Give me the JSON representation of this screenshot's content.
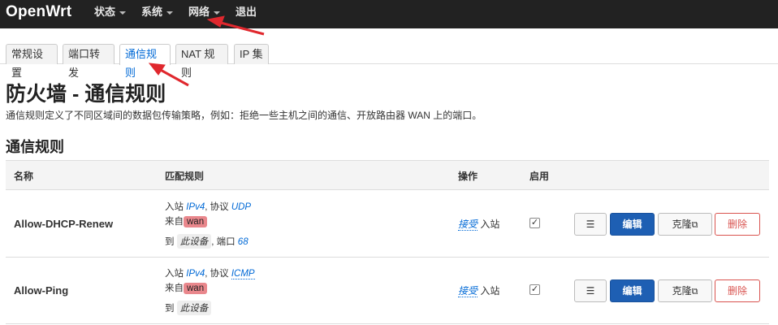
{
  "brand": "OpenWrt",
  "menu": [
    {
      "label": "状态",
      "has_caret": true
    },
    {
      "label": "系统",
      "has_caret": true
    },
    {
      "label": "网络",
      "has_caret": true
    },
    {
      "label": "退出",
      "has_caret": false
    }
  ],
  "tabs": [
    {
      "label": "常规设置",
      "active": false
    },
    {
      "label": "端口转发",
      "active": false
    },
    {
      "label": "通信规则",
      "active": true
    },
    {
      "label": "NAT 规则",
      "active": false
    },
    {
      "label": "IP 集",
      "active": false
    }
  ],
  "page": {
    "title": "防火墙 - 通信规则",
    "description": "通信规则定义了不同区域间的数据包传输策略，例如：拒绝一些主机之间的通信、开放路由器 WAN 上的端口。",
    "section_title": "通信规则"
  },
  "table": {
    "headers": {
      "name": "名称",
      "match": "匹配规则",
      "action": "操作",
      "enable": "启用"
    },
    "rows": [
      {
        "name": "Allow-DHCP-Renew",
        "match": {
          "inbound_prefix": "入站",
          "family": "IPv4",
          "proto_label": ", 协议",
          "proto": "UDP",
          "from_label": "来自",
          "zone": "wan",
          "to_label": "到",
          "device": "此设备",
          "port_label": ", 端口",
          "port": "68"
        },
        "action": {
          "verb": "接受",
          "suffix": "入站"
        },
        "enabled": true
      },
      {
        "name": "Allow-Ping",
        "match": {
          "inbound_prefix": "入站",
          "family": "IPv4",
          "proto_label": ", 协议",
          "proto": "ICMP",
          "from_label": "来自",
          "zone": "wan",
          "to_label": "到",
          "device": "此设备"
        },
        "action": {
          "verb": "接受",
          "suffix": "入站"
        },
        "enabled": true
      }
    ]
  },
  "buttons": {
    "menu": "☰",
    "edit": "编辑",
    "clone": "克隆",
    "delete": "删除"
  },
  "colors": {
    "topbar": "#222222",
    "zone_wan": "#e9878c",
    "primary": "#1e5fb3",
    "danger": "#d9534f",
    "annotation": "#e0282e"
  }
}
